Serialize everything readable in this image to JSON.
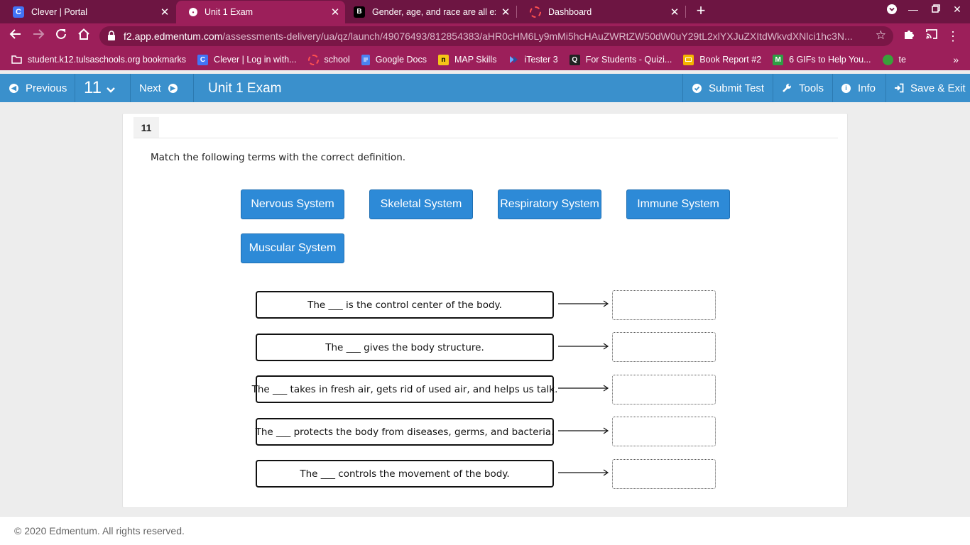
{
  "browser": {
    "tabs": [
      {
        "title": "Clever | Portal",
        "favicon": "C"
      },
      {
        "title": "Unit 1 Exam",
        "favicon": "•"
      },
      {
        "title": "Gender, age, and race are all exa",
        "favicon": "B"
      },
      {
        "title": "Dashboard",
        "favicon": ""
      }
    ],
    "url_domain": "f2.app.edmentum.com",
    "url_path": "/assessments-delivery/ua/qz/launch/49076493/812854383/aHR0cHM6Ly9mMi5hcHAuZWRtZW50dW0uY29tL2xlYXJuZXItdWkvdXNlci1hc3N...",
    "bookmarks": [
      {
        "label": "student.k12.tulsaschools.org bookmarks",
        "icon": "folder-icon"
      },
      {
        "label": "Clever | Log in with...",
        "icon": "clever-icon"
      },
      {
        "label": "school",
        "icon": "dashboard-icon"
      },
      {
        "label": "Google Docs",
        "icon": "docs-icon"
      },
      {
        "label": "MAP Skills",
        "icon": "map-icon"
      },
      {
        "label": "iTester 3",
        "icon": "itester-icon"
      },
      {
        "label": "For Students - Quizi...",
        "icon": "quizizz-icon"
      },
      {
        "label": "Book Report #2",
        "icon": "slides-icon"
      },
      {
        "label": "6 GIFs to Help You...",
        "icon": "m-icon"
      },
      {
        "label": "te",
        "icon": "circle-icon"
      }
    ],
    "more_bookmarks": "»"
  },
  "header": {
    "previous": "Previous",
    "question_number": "11",
    "next": "Next",
    "title": "Unit 1 Exam",
    "submit": "Submit Test",
    "tools": "Tools",
    "info": "Info",
    "save_exit": "Save & Exit"
  },
  "question": {
    "number": "11",
    "prompt": "Match the following terms with the correct definition.",
    "terms": [
      "Nervous System",
      "Skeletal System",
      "Respiratory System",
      "Immune System",
      "Muscular System"
    ],
    "definitions": [
      "The ___ is the control center of the body.",
      "The ___ gives the body structure.",
      "The ___ takes in fresh air, gets rid of used air, and helps us talk.",
      "The ___ protects the body from diseases, germs, and bacteria.",
      "The ___ controls the movement of the body."
    ]
  },
  "footer": {
    "copyright": "© 2020 Edmentum. All rights reserved."
  },
  "colors": {
    "tabstrip": "#6d1542",
    "toolbar": "#9c1f5a",
    "header_blue": "#3a90cc",
    "term_blue": "#2d8ad7"
  }
}
